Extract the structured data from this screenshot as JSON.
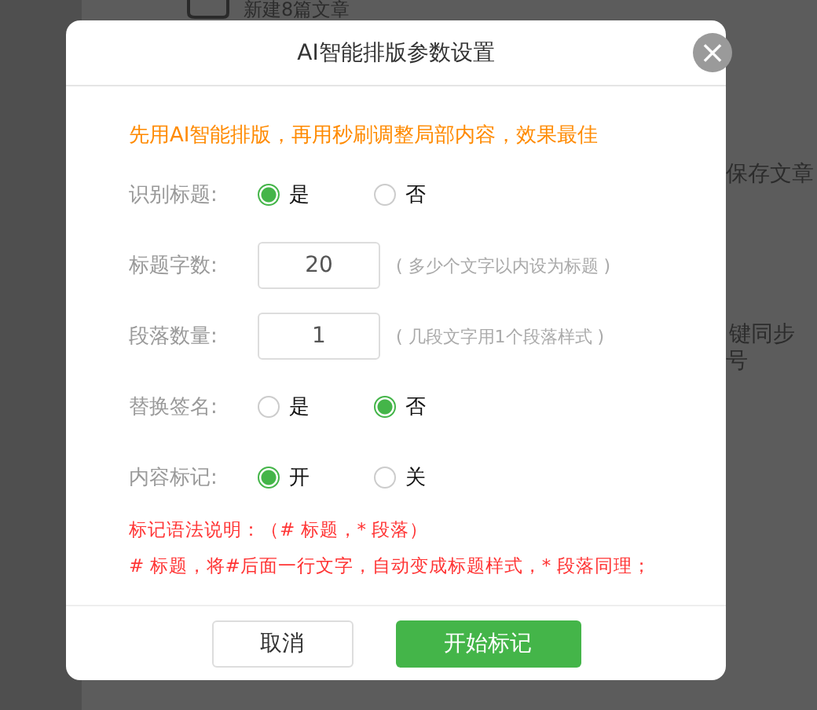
{
  "background": {
    "items": [
      "新建8篇文章",
      "保存文章",
      "键同步",
      "号"
    ]
  },
  "dialog": {
    "title": "AI智能排版参数设置",
    "close": "×",
    "tip": "先用AI智能排版，再用秒刷调整局部内容，效果最佳",
    "rows": [
      {
        "kind": "radio",
        "label": "识别标题:",
        "options": [
          {
            "label": "是",
            "selected": true
          },
          {
            "label": "否",
            "selected": false
          }
        ]
      },
      {
        "kind": "number",
        "label": "标题字数:",
        "value": "20",
        "hint": "( 多少个文字以内设为标题 )"
      },
      {
        "kind": "number",
        "label": "段落数量:",
        "value": "1",
        "hint": "( 几段文字用1个段落样式 )"
      },
      {
        "kind": "radio",
        "label": "替换签名:",
        "options": [
          {
            "label": "是",
            "selected": false
          },
          {
            "label": "否",
            "selected": true
          }
        ]
      },
      {
        "kind": "radio",
        "label": "内容标记:",
        "options": [
          {
            "label": "开",
            "selected": true
          },
          {
            "label": "关",
            "selected": false
          }
        ]
      }
    ],
    "notes": [
      "标记语法说明：（# 标题，* 段落）",
      "# 标题，将#后面一行文字，自动变成标题样式，* 段落同理；"
    ],
    "buttons": [
      {
        "label": "取消",
        "kind": "secondary"
      },
      {
        "label": "开始标记",
        "kind": "primary"
      }
    ]
  }
}
